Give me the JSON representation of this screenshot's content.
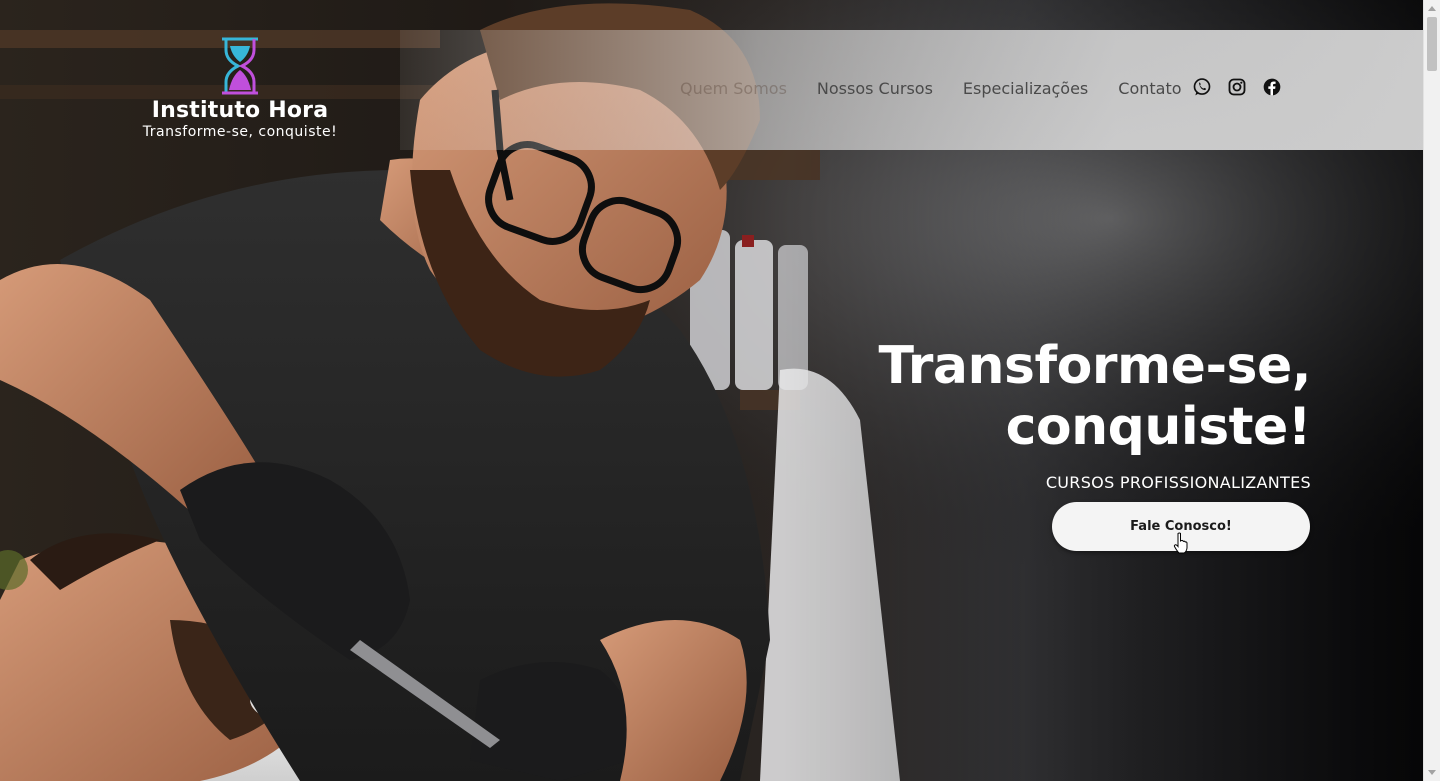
{
  "brand": {
    "name": "Instituto Hora",
    "tagline": "Transforme-se, conquiste!",
    "logo_icon": "hourglass-icon"
  },
  "nav": {
    "items": [
      {
        "label": "Quem Somos"
      },
      {
        "label": "Nossos Cursos"
      },
      {
        "label": "Especializações"
      },
      {
        "label": "Contato"
      }
    ],
    "social": [
      {
        "icon": "whatsapp-icon"
      },
      {
        "icon": "instagram-icon"
      },
      {
        "icon": "facebook-icon"
      }
    ]
  },
  "hero": {
    "title_line1": "Transforme-se,",
    "title_line2": "conquiste!",
    "subtitle": "CURSOS PROFISSIONALIZANTES",
    "cta_label": "Fale Conosco!",
    "image": "barber-shaving-client-photo"
  },
  "colors": {
    "logo_cyan": "#37b6d8",
    "logo_purple": "#c04fdc",
    "nav_text": "#4a4a4a",
    "cta_bg": "#f4f4f4",
    "headline": "#ffffff"
  }
}
